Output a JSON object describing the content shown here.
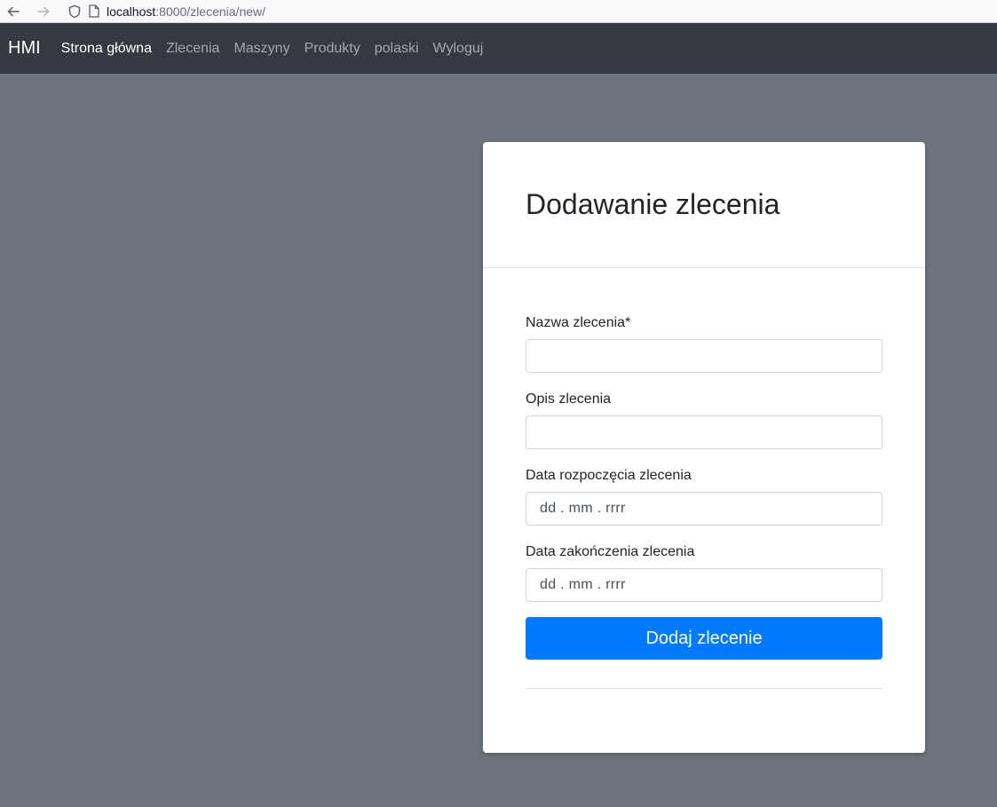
{
  "browser": {
    "url_host": "localhost",
    "url_path": ":8000/zlecenia/new/"
  },
  "navbar": {
    "brand": "HMI",
    "links": [
      {
        "label": "Strona główna",
        "active": true
      },
      {
        "label": "Zlecenia",
        "active": false
      },
      {
        "label": "Maszyny",
        "active": false
      },
      {
        "label": "Produkty",
        "active": false
      },
      {
        "label": "polaski",
        "active": false
      },
      {
        "label": "Wyloguj",
        "active": false
      }
    ]
  },
  "form": {
    "title": "Dodawanie zlecenia",
    "fields": {
      "name": {
        "label": "Nazwa zlecenia*",
        "value": ""
      },
      "description": {
        "label": "Opis zlecenia",
        "value": ""
      },
      "start_date": {
        "label": "Data rozpoczęcia zlecenia",
        "placeholder": "dd . mm . rrrr"
      },
      "end_date": {
        "label": "Data zakończenia zlecenia",
        "placeholder": "dd . mm . rrrr"
      }
    },
    "submit_label": "Dodaj zlecenie"
  },
  "colors": {
    "navbar_bg": "#343a40",
    "page_bg": "#6c757d",
    "primary": "#007bff"
  }
}
